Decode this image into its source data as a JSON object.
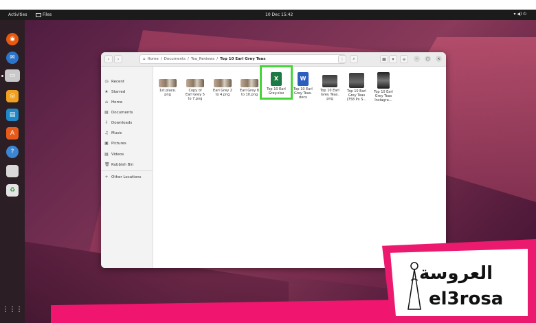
{
  "topbar": {
    "activities": "Activities",
    "app_name": "Files",
    "clock": "10 Dec  15:42",
    "tray": "▾  ◀)  ⏻"
  },
  "dock": {
    "apps": [
      "firefox-icon",
      "thunderbird-icon",
      "files-icon",
      "rhythmbox-icon",
      "writer-icon",
      "software-icon",
      "help-icon",
      "drive-icon",
      "trash-icon"
    ],
    "grid_icon": "⋮⋮⋮"
  },
  "window": {
    "path": {
      "home": "Home",
      "seg1": "Documents",
      "seg2": "Tea_Reviews",
      "current": "Top 10 Earl Grey Teas"
    },
    "sidebar": {
      "items": [
        {
          "label": "Recent",
          "icon": "◷"
        },
        {
          "label": "Starred",
          "icon": "★"
        },
        {
          "label": "Home",
          "icon": "⌂"
        },
        {
          "label": "Documents",
          "icon": "▤"
        },
        {
          "label": "Downloads",
          "icon": "⇩"
        },
        {
          "label": "Music",
          "icon": "♫"
        },
        {
          "label": "Pictures",
          "icon": "▣"
        },
        {
          "label": "Videos",
          "icon": "▤"
        },
        {
          "label": "Rubbish Bin",
          "icon": "🗑"
        }
      ],
      "other": {
        "label": "Other Locations",
        "icon": "+"
      }
    },
    "files": [
      {
        "name": "1st place.\npng",
        "kind": "photos"
      },
      {
        "name": "Copy of\nEarl Grey 5\nto 7.png",
        "kind": "photos"
      },
      {
        "name": "Earl Grey 2\nto 4.png",
        "kind": "photos"
      },
      {
        "name": "Earl Grey 8\nto 10.png",
        "kind": "photos"
      },
      {
        "name": "Top 10 Earl\nGrey.xlsx",
        "kind": "xlsx",
        "glyph": "X"
      },
      {
        "name": "Top 10 Earl\nGrey Teas.\ndocx",
        "kind": "docx",
        "glyph": "W"
      },
      {
        "name": "Top 10 Earl\nGrey Teas.\npng",
        "kind": "dark"
      },
      {
        "name": "Top 10 Earl\nGrey Teas\n(758 Px S…",
        "kind": "dark"
      },
      {
        "name": "Top 10 Earl\nGrey Teas\nInstagra…",
        "kind": "tall"
      }
    ]
  },
  "watermark": {
    "arabic": "العروسة",
    "latin": "el3rosa"
  },
  "colors": {
    "highlight": "#45d43a",
    "banner": "#ec1a6e"
  }
}
